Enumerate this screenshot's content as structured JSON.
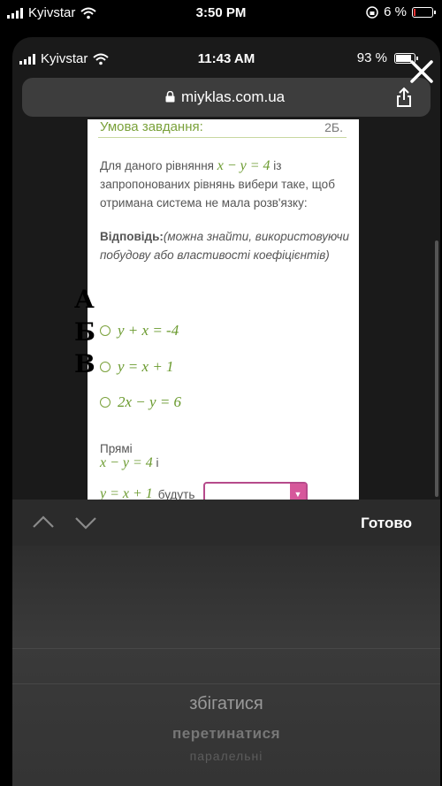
{
  "outer_status": {
    "carrier": "Kyivstar",
    "time": "3:50 PM",
    "battery": "6 %"
  },
  "inner_status": {
    "carrier": "Kyivstar",
    "time": "11:43 AM",
    "battery": "93 %"
  },
  "browser": {
    "url": "miyklas.com.ua"
  },
  "task": {
    "heading": "Умова завдання:",
    "number": "2Б.",
    "text_before": "Для даного рівняння ",
    "equation": "x − y = 4",
    "text_after": " із запропонованих рівнянь вибери таке, щоб отримана система не мала розв'язку:",
    "answer_label": "Відповідь:",
    "answer_hint": "(можна знайти, використовуючи побудову або властивості коефіцієнтів)",
    "options": [
      {
        "mark": "А",
        "equation": "y + x = -4"
      },
      {
        "mark": "Б",
        "equation": "y = x + 1"
      },
      {
        "mark": "В",
        "equation": "2x − y = 6"
      }
    ],
    "lines_label": "Прямі",
    "line1_eq": "x − y = 4",
    "line1_suffix": " і",
    "line2_eq": "y = x + 1",
    "line2_suffix": "будуть"
  },
  "toolbar": {
    "done": "Готово"
  },
  "picker": {
    "options": [
      "збігатися",
      "перетинатися",
      "паралельні"
    ]
  },
  "colors": {
    "accent_green": "#7aa13a",
    "select_border": "#b64a8b"
  }
}
